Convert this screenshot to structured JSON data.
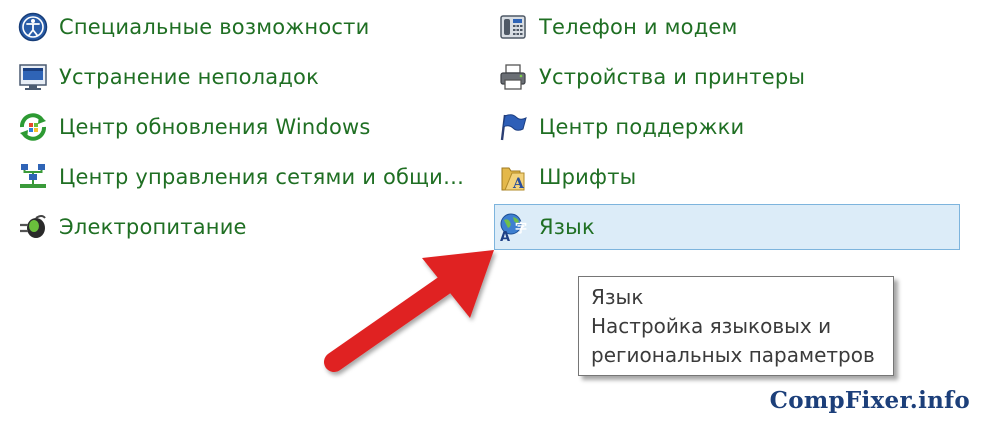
{
  "left_items": [
    {
      "label": "Специальные возможности",
      "icon": "accessibility-icon"
    },
    {
      "label": "Устранение неполадок",
      "icon": "troubleshooting-icon"
    },
    {
      "label": "Центр обновления Windows",
      "icon": "windows-update-icon"
    },
    {
      "label": "Центр управления сетями и общи…",
      "icon": "network-center-icon"
    },
    {
      "label": "Электропитание",
      "icon": "power-options-icon"
    }
  ],
  "right_items": [
    {
      "label": "Телефон и модем",
      "icon": "phone-modem-icon"
    },
    {
      "label": "Устройства и принтеры",
      "icon": "printer-icon"
    },
    {
      "label": "Центр поддержки",
      "icon": "action-center-flag-icon"
    },
    {
      "label": "Шрифты",
      "icon": "fonts-folder-icon"
    },
    {
      "label": "Язык",
      "icon": "language-icon",
      "selected": true
    }
  ],
  "tooltip": {
    "title": "Язык",
    "line2": "Настройка языковых и",
    "line3": "региональных параметров"
  },
  "watermark": {
    "brand": "CompFixer.info"
  },
  "colors": {
    "link_green": "#1f6f23",
    "selection_bg": "#dcecf8",
    "selection_border": "#7db4dd",
    "arrow_red": "#e02020",
    "watermark_blue": "#1c3f7a"
  }
}
